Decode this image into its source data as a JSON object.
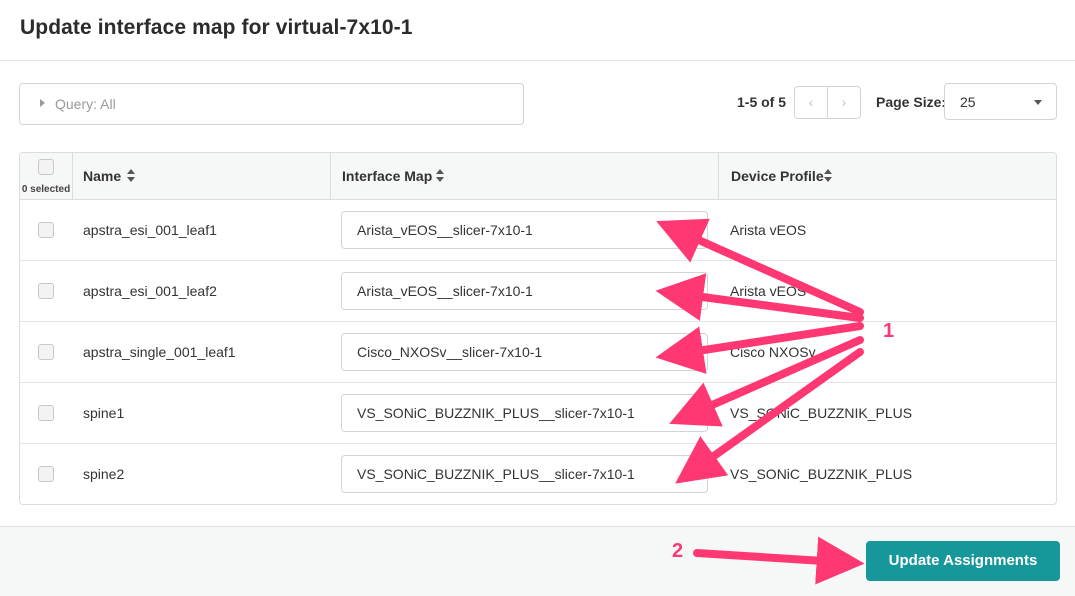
{
  "dialog": {
    "title": "Update interface map for virtual-7x10-1"
  },
  "query": {
    "label": "Query: All"
  },
  "pagination": {
    "range": "1-5 of 5",
    "prev_icon": "chevron-left-icon",
    "next_icon": "chevron-right-icon",
    "prev": "‹",
    "next": "›",
    "page_size_label": "Page Size:",
    "page_size_value": "25"
  },
  "table": {
    "selected_count": "0 selected",
    "columns": [
      "Name",
      "Interface Map",
      "Device Profile"
    ],
    "rows": [
      {
        "name": "apstra_esi_001_leaf1",
        "interface_map": "Arista_vEOS__slicer-7x10-1",
        "device_profile": "Arista vEOS",
        "checked": false
      },
      {
        "name": "apstra_esi_001_leaf2",
        "interface_map": "Arista_vEOS__slicer-7x10-1",
        "device_profile": "Arista vEOS",
        "checked": false
      },
      {
        "name": "apstra_single_001_leaf1",
        "interface_map": "Cisco_NXOSv__slicer-7x10-1",
        "device_profile": "Cisco NXOSv",
        "checked": false
      },
      {
        "name": "spine1",
        "interface_map": "VS_SONiC_BUZZNIK_PLUS__slicer-7x10-1",
        "device_profile": "VS_SONiC_BUZZNIK_PLUS",
        "checked": false
      },
      {
        "name": "spine2",
        "interface_map": "VS_SONiC_BUZZNIK_PLUS__slicer-7x10-1",
        "device_profile": "VS_SONiC_BUZZNIK_PLUS",
        "checked": false
      }
    ]
  },
  "footer": {
    "update_button": "Update Assignments"
  },
  "annotations": {
    "callout_1": "1",
    "callout_2": "2",
    "arrow_color": "#ff3874"
  },
  "colors": {
    "primary_button": "#18979a",
    "header_bg": "#f6f7f7"
  }
}
